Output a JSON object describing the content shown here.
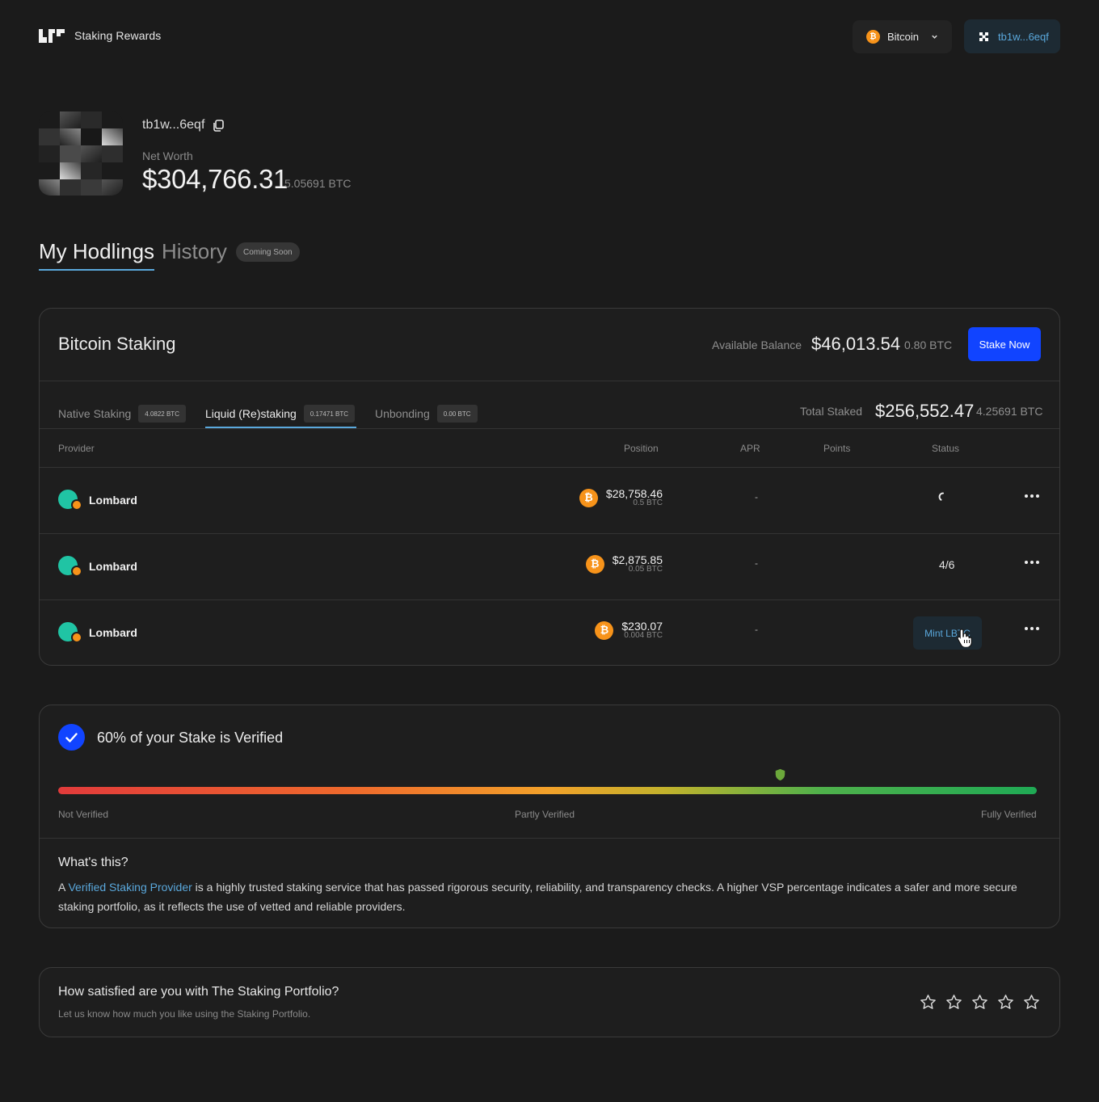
{
  "header": {
    "brand": "Staking Rewards",
    "network": "Bitcoin",
    "wallet": "tb1w...6eqf"
  },
  "profile": {
    "address": "tb1w...6eqf",
    "net_worth_label": "Net Worth",
    "net_worth_usd": "$304,766.31",
    "net_worth_btc": "5.05691 BTC"
  },
  "page_tabs": {
    "hodlings": "My Hodlings",
    "history": "History",
    "coming_soon": "Coming Soon"
  },
  "staking": {
    "title": "Bitcoin Staking",
    "available_label": "Available Balance",
    "available_usd": "$46,013.54",
    "available_btc": "0.80 BTC",
    "stake_button": "Stake Now",
    "tabs": [
      {
        "label": "Native Staking",
        "badge": "4.0822 BTC",
        "active": false
      },
      {
        "label": "Liquid (Re)staking",
        "badge": "0.17471 BTC",
        "active": true
      },
      {
        "label": "Unbonding",
        "badge": "0.00 BTC",
        "active": false
      }
    ],
    "total_staked_label": "Total Staked",
    "total_staked_usd": "$256,552.47",
    "total_staked_btc": "4.25691 BTC",
    "columns": [
      "Provider",
      "Position",
      "APR",
      "Points",
      "Status"
    ],
    "rows": [
      {
        "provider": "Lombard",
        "position_usd": "$28,758.46",
        "position_btc": "0.5 BTC",
        "apr": "-",
        "status": ""
      },
      {
        "provider": "Lombard",
        "position_usd": "$2,875.85",
        "position_btc": "0.05 BTC",
        "apr": "-",
        "status": "4/6"
      },
      {
        "provider": "Lombard",
        "position_usd": "$230.07",
        "position_btc": "0.004 BTC",
        "apr": "-",
        "status": "Mint LBTC"
      }
    ]
  },
  "verification": {
    "title": "60% of your Stake is Verified",
    "percent": 60,
    "labels": [
      "Not Verified",
      "Partly Verified",
      "Fully Verified"
    ],
    "whats_this": "What's this?",
    "desc_prefix": "A ",
    "desc_link": "Verified Staking Provider",
    "desc_rest": " is a highly trusted staking service that has passed rigorous security, reliability, and transparency checks.  A higher VSP percentage indicates a safer and more secure staking portfolio, as it reflects the use of vetted and reliable providers."
  },
  "feedback": {
    "question": "How satisfied are you with The Staking Portfolio?",
    "subtitle": "Let us know how much you like using the Staking Portfolio.",
    "rating": 0,
    "max_rating": 5
  },
  "colors": {
    "accent_blue": "#1144ff",
    "link_blue": "#5aa8dc",
    "bitcoin_orange": "#f7931a",
    "lombard_teal": "#20c4a4"
  }
}
